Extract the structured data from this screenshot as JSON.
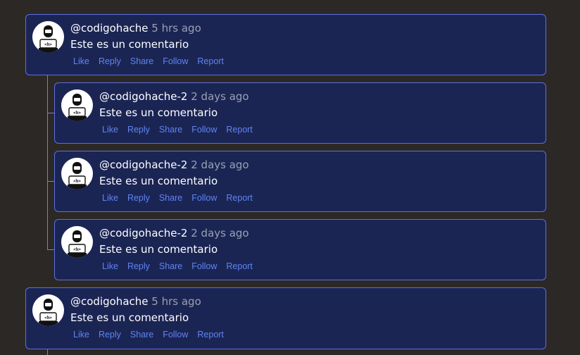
{
  "comments": [
    {
      "username": "@codigohache",
      "time": "5 hrs ago",
      "text": "Este es un comentario"
    },
    {
      "username": "@codigohache-2",
      "time": "2 days ago",
      "text": "Este es un comentario"
    },
    {
      "username": "@codigohache-2",
      "time": "2 days ago",
      "text": "Este es un comentario"
    },
    {
      "username": "@codigohache-2",
      "time": "2 days ago",
      "text": "Este es un comentario"
    },
    {
      "username": "@codigohache",
      "time": "5 hrs ago",
      "text": "Este es un comentario"
    }
  ],
  "actions": {
    "like": "Like",
    "reply": "Reply",
    "share": "Share",
    "follow": "Follow",
    "report": "Report"
  },
  "avatar_badge": "<h>",
  "colors": {
    "background": "#2c2826",
    "card": "#1b2554",
    "border": "#5c6fe0",
    "link": "#5f84f3"
  }
}
